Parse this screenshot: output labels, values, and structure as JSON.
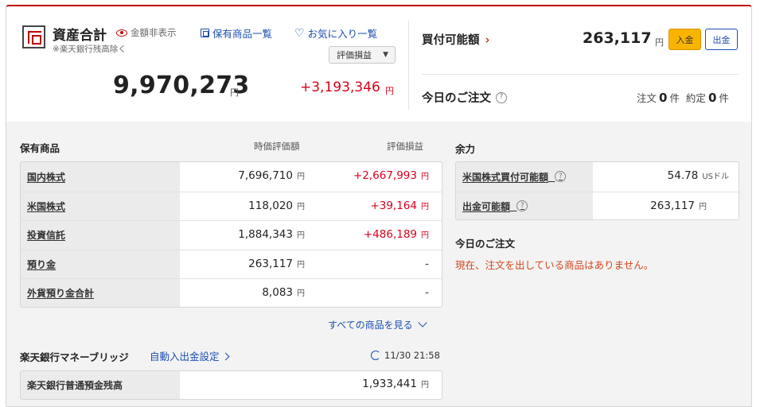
{
  "summary": {
    "title": "資産合計",
    "hide_toggle": "金額非表示",
    "note": "※楽天銀行残高除く",
    "holdings_link": "保有商品一覧",
    "favorites_link": "お気に入り一覧",
    "eval_select": "評価損益",
    "total_value": "9,970,273",
    "total_unit": "円",
    "total_gain": "+3,193,346",
    "gain_unit": "円"
  },
  "buying": {
    "label": "買付可能額",
    "value": "263,117",
    "unit": "円",
    "deposit": "入金",
    "withdraw": "出金"
  },
  "orders": {
    "label": "今日のご注文",
    "order_label": "注文",
    "order_count": "0",
    "filled_label": "約定",
    "filled_count": "0",
    "count_unit": "件"
  },
  "holdings": {
    "title": "保有商品",
    "col_value": "時価評価額",
    "col_pl": "評価損益",
    "unit": "円",
    "rows": [
      {
        "label": "国内株式",
        "value": "7,696,710",
        "pl": "+2,667,993"
      },
      {
        "label": "米国株式",
        "value": "118,020",
        "pl": "+39,164"
      },
      {
        "label": "投資信託",
        "value": "1,884,343",
        "pl": "+486,189"
      },
      {
        "label": "預り金",
        "value": "263,117",
        "pl": "-"
      },
      {
        "label": "外貨預り金合計",
        "value": "8,083",
        "pl": "-"
      }
    ],
    "see_all": "すべての商品を見る"
  },
  "bridge": {
    "title": "楽天銀行マネーブリッジ",
    "auto_link": "自動入出金設定",
    "timestamp": "11/30 21:58",
    "row_label": "楽天銀行普通預金残高",
    "row_value": "1,933,441",
    "unit": "円"
  },
  "margin": {
    "title": "余力",
    "rows": [
      {
        "label": "米国株式買付可能額",
        "value": "54.78",
        "unit": "USドル"
      },
      {
        "label": "出金可能額",
        "value": "263,117",
        "unit": "円"
      }
    ]
  },
  "today_orders": {
    "title": "今日のご注文",
    "empty_message": "現在、注文を出している商品はありません。"
  },
  "colors": {
    "brand_red": "#bf0000",
    "gain_red": "#d9001b",
    "link_blue": "#1d4fb0",
    "deposit_yellow": "#f9b400",
    "notice_orange": "#d2461c"
  }
}
